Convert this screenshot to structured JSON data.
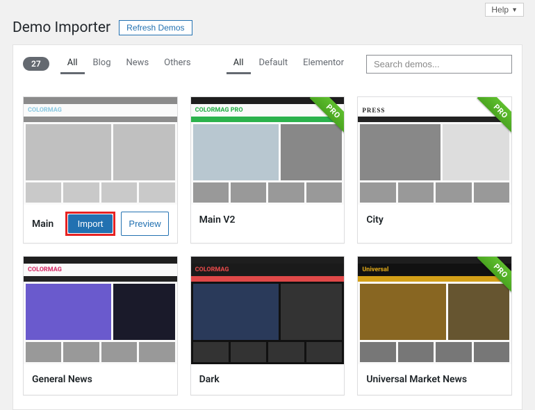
{
  "help_label": "Help",
  "page_title": "Demo Importer",
  "refresh_label": "Refresh Demos",
  "count": "27",
  "category_filters": [
    {
      "label": "All",
      "active": true
    },
    {
      "label": "Blog",
      "active": false
    },
    {
      "label": "News",
      "active": false
    },
    {
      "label": "Others",
      "active": false
    }
  ],
  "builder_filters": [
    {
      "label": "All",
      "active": true
    },
    {
      "label": "Default",
      "active": false
    },
    {
      "label": "Elementor",
      "active": false
    }
  ],
  "search_placeholder": "Search demos...",
  "import_label": "Import",
  "preview_label": "Preview",
  "pro_label": "PRO",
  "demos": [
    {
      "title": "Main",
      "pro": false,
      "selected": true,
      "brand": "COLORMAG",
      "variant": "light"
    },
    {
      "title": "Main V2",
      "pro": true,
      "selected": false,
      "brand": "COLORMAG PRO",
      "variant": "green"
    },
    {
      "title": "City",
      "pro": true,
      "selected": false,
      "brand": "PRESS",
      "variant": "press"
    },
    {
      "title": "General News",
      "pro": false,
      "selected": false,
      "brand": "COLORMAG",
      "variant": "pink"
    },
    {
      "title": "Dark",
      "pro": false,
      "selected": false,
      "brand": "COLORMAG",
      "variant": "dark"
    },
    {
      "title": "Universal Market News",
      "pro": true,
      "selected": false,
      "brand": "Universal",
      "variant": "gold"
    }
  ]
}
